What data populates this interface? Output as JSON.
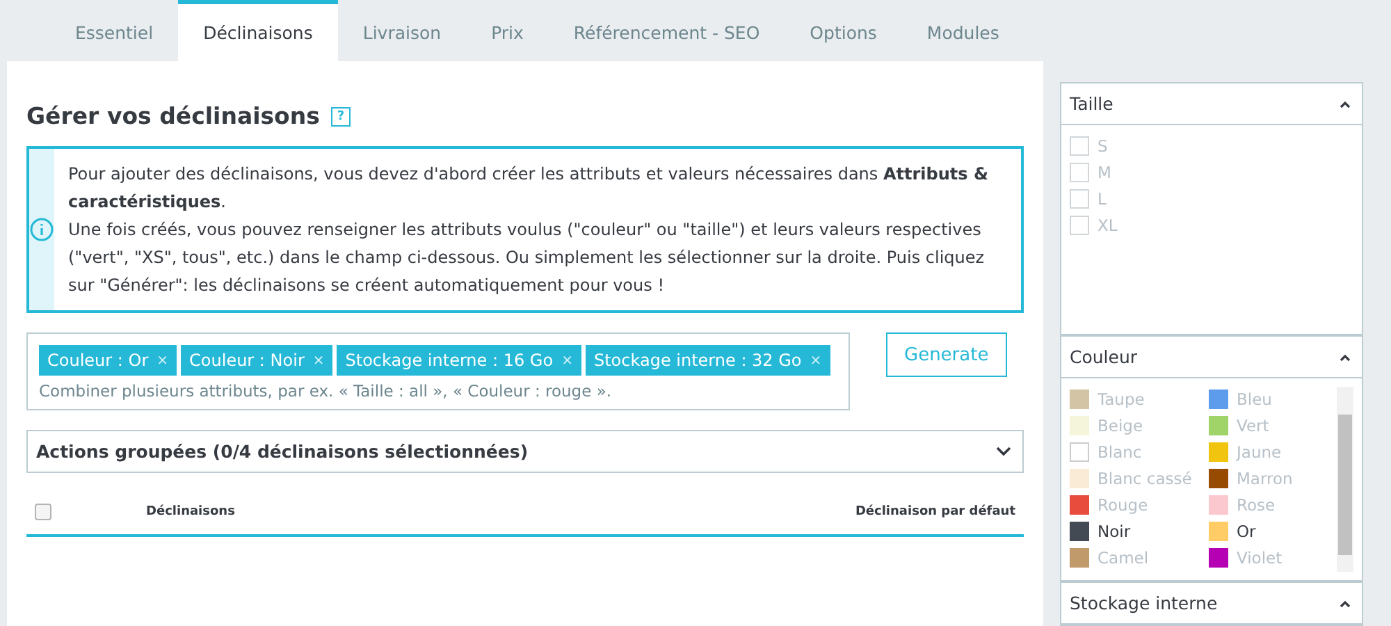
{
  "tabs": [
    {
      "label": "Essentiel",
      "selected": false
    },
    {
      "label": "Déclinaisons",
      "selected": true
    },
    {
      "label": "Livraison",
      "selected": false
    },
    {
      "label": "Prix",
      "selected": false
    },
    {
      "label": "Référencement - SEO",
      "selected": false
    },
    {
      "label": "Options",
      "selected": false
    },
    {
      "label": "Modules",
      "selected": false
    }
  ],
  "heading": {
    "title": "Gérer vos déclinaisons",
    "help": "?"
  },
  "info": {
    "text": "Pour ajouter des déclinaisons, vous devez d'abord créer les attributs et valeurs nécessaires dans **Attributs & caractéristiques**.\nUne fois créés, vous pouvez renseigner les attributs voulus (\"couleur\" ou \"taille\") et leurs valeurs respectives (\"vert\", \"XS\", tous\", etc.) dans le champ ci-dessous. Ou simplement les sélectionner sur la droite. Puis cliquez sur \"Générer\": les déclinaisons se créent automatiquement pour vous !"
  },
  "tags": [
    {
      "label": "Couleur : Or",
      "remove": "×"
    },
    {
      "label": "Couleur : Noir",
      "remove": "×"
    },
    {
      "label": "Stockage interne : 16 Go",
      "remove": "×"
    },
    {
      "label": "Stockage interne : 32 Go",
      "remove": "×"
    }
  ],
  "tag_input": {
    "placeholder": "Combiner plusieurs attributs, par ex. « Taille : all », « Couleur : rouge »."
  },
  "generate_button": "Generate",
  "bulk_actions": {
    "label": "Actions groupées (0/4 déclinaisons sélectionnées)",
    "expanded": false
  },
  "table": {
    "select_all": {
      "checked": false
    },
    "columns": [
      "Déclinaisons",
      "Déclinaison par défaut"
    ]
  },
  "attributes": [
    {
      "title": "Taille",
      "expanded": true,
      "kind": "checkbox",
      "values": [
        {
          "label": "S",
          "selected": false
        },
        {
          "label": "M",
          "selected": false
        },
        {
          "label": "L",
          "selected": false
        },
        {
          "label": "XL",
          "selected": false
        }
      ]
    },
    {
      "title": "Couleur",
      "expanded": true,
      "kind": "color",
      "values": [
        {
          "label": "Taupe",
          "color": "#d2c4a5",
          "selected": false
        },
        {
          "label": "Bleu",
          "color": "#5d9cec",
          "selected": false
        },
        {
          "label": "Beige",
          "color": "#f5f5dc",
          "selected": false
        },
        {
          "label": "Vert",
          "color": "#a0d468",
          "selected": false
        },
        {
          "label": "Blanc",
          "color": "#ffffff",
          "selected": false
        },
        {
          "label": "Jaune",
          "color": "#f1c40f",
          "selected": false
        },
        {
          "label": "Blanc cassé",
          "color": "#faebd7",
          "selected": false
        },
        {
          "label": "Marron",
          "color": "#964b00",
          "selected": false
        },
        {
          "label": "Rouge",
          "color": "#e84c3d",
          "selected": false
        },
        {
          "label": "Rose",
          "color": "#fcc8d0",
          "selected": false
        },
        {
          "label": "Noir",
          "color": "#434a54",
          "selected": true
        },
        {
          "label": "Or",
          "color": "#ffcc66",
          "selected": true
        },
        {
          "label": "Camel",
          "color": "#c19a6b",
          "selected": false
        },
        {
          "label": "Violet",
          "color": "#b600b3",
          "selected": false
        }
      ]
    },
    {
      "title": "Stockage interne",
      "expanded": true
    }
  ]
}
